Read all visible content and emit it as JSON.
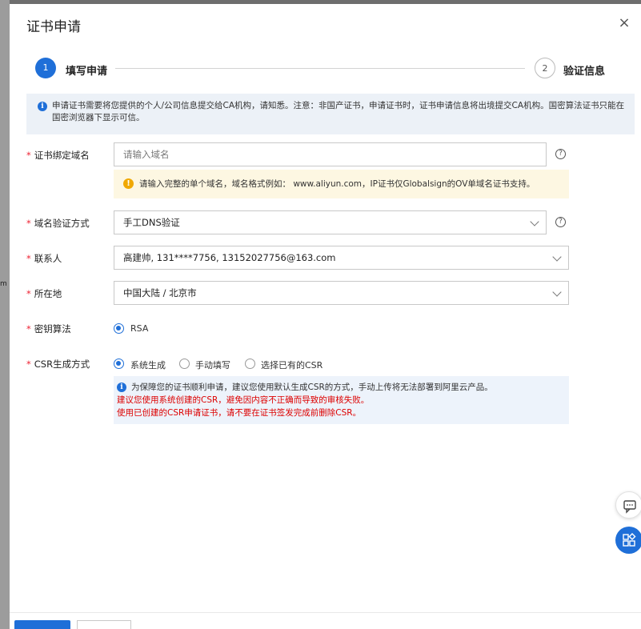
{
  "dialog": {
    "title": "证书申请",
    "close_glyph": "×"
  },
  "steps": [
    {
      "number": "1",
      "label": "填写申请",
      "active": true
    },
    {
      "number": "2",
      "label": "验证信息",
      "active": false
    }
  ],
  "notice": {
    "icon": "info-icon",
    "text": "申请证书需要将您提供的个人/公司信息提交给CA机构，请知悉。注意：非国产证书，申请证书时，证书申请信息将出境提交CA机构。国密算法证书只能在国密浏览器下显示可信。"
  },
  "form": {
    "domain": {
      "label": "证书绑定域名",
      "placeholder": "请输入域名",
      "hint": "请输入完整的单个域名，域名格式例如： www.aliyun.com，IP证书仅Globalsign的OV单域名证书支持。"
    },
    "verify_method": {
      "label": "域名验证方式",
      "value": "手工DNS验证"
    },
    "contact": {
      "label": "联系人",
      "value": "高建帅, 131****7756, 13152027756@163.com"
    },
    "location": {
      "label": "所在地",
      "value": "中国大陆 / 北京市"
    },
    "key_algorithm": {
      "label": "密钥算法",
      "options": [
        {
          "label": "RSA",
          "selected": true
        }
      ]
    },
    "csr_method": {
      "label": "CSR生成方式",
      "options": [
        {
          "label": "系统生成",
          "selected": true
        },
        {
          "label": "手动填写",
          "selected": false
        },
        {
          "label": "选择已有的CSR",
          "selected": false
        }
      ],
      "info_text": "为保障您的证书顺利申请，建议您使用默认生成CSR的方式，手动上传将无法部署到阿里云产品。",
      "warning_line1": "建议您使用系统创建的CSR，避免因内容不正确而导致的审核失败。",
      "warning_line2": "使用已创建的CSR申请证书，请不要在证书签发完成前删除CSR。"
    },
    "required_mark": "*",
    "help_glyph": "?"
  },
  "background": {
    "edge_text": "m"
  },
  "colors": {
    "primary": "#1f6fd8",
    "warning_bg": "#fdf7e2",
    "info_bg": "#ecf1f7",
    "error_text": "#dd0000"
  }
}
